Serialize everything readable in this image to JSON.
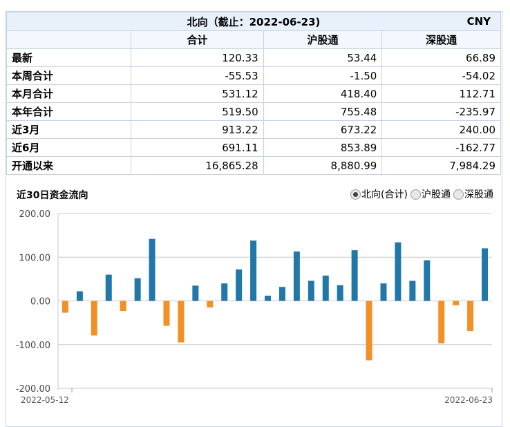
{
  "table": {
    "title": "北向（截止：2022-06-23)",
    "currency": "CNY",
    "columns": [
      "合计",
      "沪股通",
      "深股通"
    ],
    "rows": [
      {
        "label": "最新",
        "values": [
          "120.33",
          "53.44",
          "66.89"
        ]
      },
      {
        "label": "本周合计",
        "values": [
          "-55.53",
          "-1.50",
          "-54.02"
        ]
      },
      {
        "label": "本月合计",
        "values": [
          "531.12",
          "418.40",
          "112.71"
        ]
      },
      {
        "label": "本年合计",
        "values": [
          "519.50",
          "755.48",
          "-235.97"
        ]
      },
      {
        "label": "近3月",
        "values": [
          "913.22",
          "673.22",
          "240.00"
        ]
      },
      {
        "label": "近6月",
        "values": [
          "691.11",
          "853.89",
          "-162.77"
        ]
      },
      {
        "label": "开通以来",
        "values": [
          "16,865.28",
          "8,880.99",
          "7,984.29"
        ]
      }
    ]
  },
  "chart_header": {
    "title": "近30日资金流向",
    "options": [
      {
        "label": "北向(合计)",
        "selected": true
      },
      {
        "label": "沪股通",
        "selected": false
      },
      {
        "label": "深股通",
        "selected": false
      }
    ]
  },
  "chart_data": {
    "type": "bar",
    "title": "近30日资金流向",
    "ylim": [
      -200,
      200
    ],
    "y_ticks": [
      "200.00",
      "100.00",
      "0.00",
      "-100.00",
      "-200.00"
    ],
    "x_start_label": "2022-05-12",
    "x_end_label": "2022-06-23",
    "grid": true,
    "colors": {
      "positive": "#2178a8",
      "negative": "#f39025"
    },
    "values": [
      -27,
      22,
      -79,
      60,
      -23,
      52,
      142,
      -57,
      -95,
      35,
      -15,
      40,
      72,
      138,
      12,
      32,
      113,
      46,
      58,
      36,
      116,
      -136,
      40,
      134,
      46,
      93,
      -97,
      -10,
      -69,
      120.33
    ]
  }
}
